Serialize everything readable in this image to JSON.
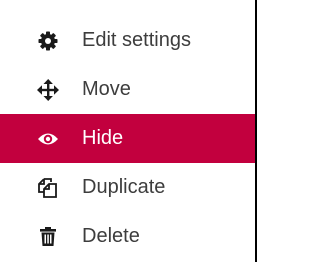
{
  "menu": {
    "items": [
      {
        "label": "Edit settings",
        "icon": "gear-icon",
        "active": false
      },
      {
        "label": "Move",
        "icon": "move-arrows-icon",
        "active": false
      },
      {
        "label": "Hide",
        "icon": "eye-icon",
        "active": true
      },
      {
        "label": "Duplicate",
        "icon": "duplicate-icon",
        "active": false
      },
      {
        "label": "Delete",
        "icon": "trash-icon",
        "active": false
      }
    ],
    "colors": {
      "active_background": "#c2003e",
      "text": "#3d3d3d",
      "active_text": "#ffffff"
    }
  }
}
